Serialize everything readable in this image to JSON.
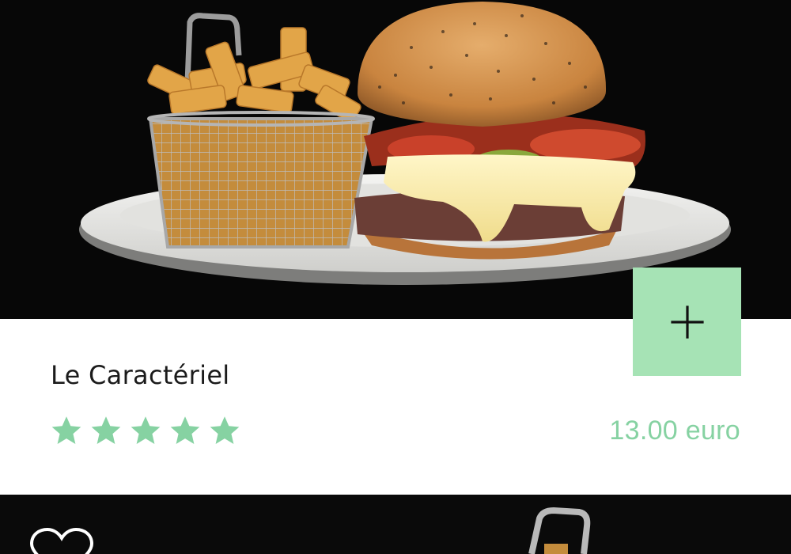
{
  "product": {
    "name": "Le Caractériel",
    "price": "13.00 euro",
    "rating": 5,
    "rating_max": 5,
    "add_button_icon": "plus-icon"
  },
  "next_product": {
    "favorite_icon": "heart-outline-icon"
  },
  "colors": {
    "accent": "#86d2a2",
    "add_button_bg": "#a6e3b5",
    "star": "#86d2a2",
    "title_text": "#1b1b1b",
    "image_bg": "#070707"
  }
}
